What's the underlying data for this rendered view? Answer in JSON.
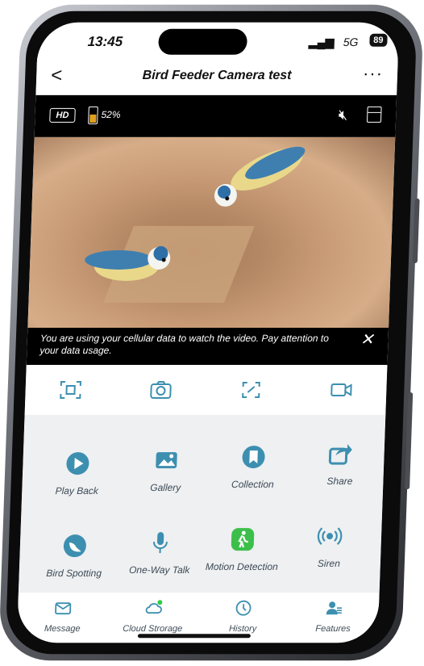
{
  "status": {
    "time": "13:45",
    "network": "5G",
    "battery": "89"
  },
  "header": {
    "title": "Bird Feeder Camera test",
    "back_symbol": "<",
    "more_symbol": "···"
  },
  "video_bar": {
    "quality": "HD",
    "battery_level": "52%",
    "battery_fraction": 0.52
  },
  "notice": {
    "text": "You are using your cellular data to watch the video. Pay attention to your data usage.",
    "close_symbol": "✕"
  },
  "toolbar": [
    "screen-capture-icon",
    "camera-icon",
    "fullscreen-icon",
    "video-record-icon"
  ],
  "features": [
    {
      "label": "Play Back",
      "icon": "play-icon"
    },
    {
      "label": "Gallery",
      "icon": "gallery-icon"
    },
    {
      "label": "Collection",
      "icon": "bookmark-icon"
    },
    {
      "label": "Share",
      "icon": "share-icon"
    },
    {
      "label": "Bird Spotting",
      "icon": "bird-icon"
    },
    {
      "label": "One-Way Talk",
      "icon": "microphone-icon"
    },
    {
      "label": "Motion Detection",
      "icon": "person-walking-icon"
    },
    {
      "label": "Siren",
      "icon": "siren-icon"
    }
  ],
  "tabs": [
    {
      "label": "Message",
      "icon": "mail-icon"
    },
    {
      "label": "Cloud Strorage",
      "icon": "cloud-icon"
    },
    {
      "label": "History",
      "icon": "clock-icon"
    },
    {
      "label": "Features",
      "icon": "user-card-icon"
    }
  ],
  "colors": {
    "accent": "#3d8fb0",
    "motion_green": "#3cbf4a",
    "cloud_dot": "#2ecc40",
    "battery_fill": "#e0a21e"
  }
}
